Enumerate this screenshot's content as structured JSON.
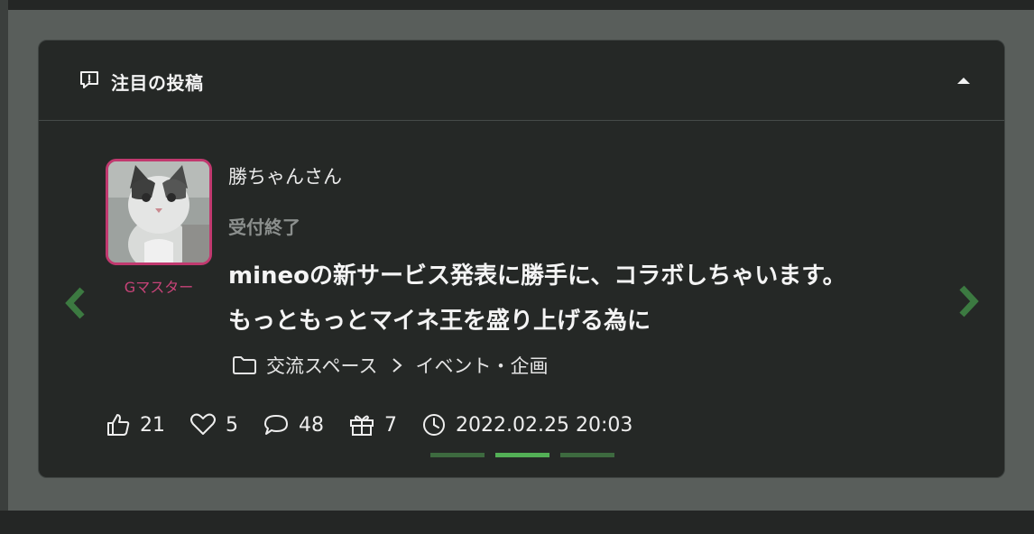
{
  "colors": {
    "accent_green": "#3f7a43",
    "rank_pink": "#c74378",
    "card_bg": "#252826"
  },
  "header": {
    "title": "注目の投稿",
    "icon": "exclamation-speech-bubble-icon",
    "collapse_icon": "caret-up-icon"
  },
  "post": {
    "author": "勝ちゃんさん",
    "rank": "Gマスター",
    "status": "受付終了",
    "title_line1": "mineoの新サービス発表に勝手に、コラボしちゃいます。",
    "title_line2": "もっともっとマイネ王を盛り上げる為に",
    "category": "交流スペース",
    "subcategory": "イベント・企画"
  },
  "stats": {
    "likes": "21",
    "hearts": "5",
    "comments": "48",
    "gifts": "7",
    "datetime": "2022.02.25 20:03"
  },
  "carousel": {
    "slides": 3,
    "active_index": 1
  }
}
